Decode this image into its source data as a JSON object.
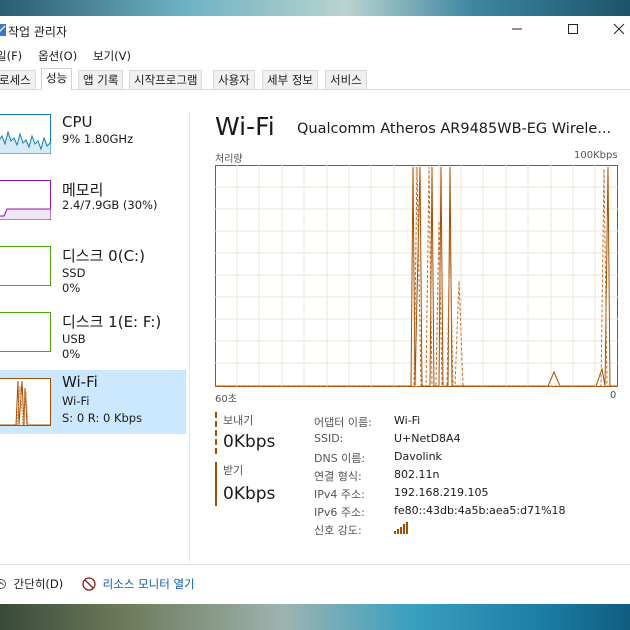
{
  "window": {
    "title": "작업 관리자"
  },
  "menu": [
    "일(F)",
    "옵션(O)",
    "보기(V)"
  ],
  "tabs": [
    "로세스",
    "성능",
    "앱 기록",
    "시작프로그램",
    "사용자",
    "세부 정보",
    "서비스"
  ],
  "sidebar": {
    "items": [
      {
        "title": "CPU",
        "sub1": "9% 1.80GHz",
        "sub2": "",
        "sub3": ""
      },
      {
        "title": "메모리",
        "sub1": "2.4/7.9GB (30%)",
        "sub2": "",
        "sub3": ""
      },
      {
        "title": "디스크 0(C:)",
        "sub1": "SSD",
        "sub2": "0%",
        "sub3": ""
      },
      {
        "title": "디스크 1(E: F:)",
        "sub1": "USB",
        "sub2": "0%",
        "sub3": ""
      },
      {
        "title": "Wi-Fi",
        "sub1": "Wi-Fi",
        "sub2": "S: 0 R: 0 Kbps",
        "sub3": ""
      }
    ]
  },
  "main": {
    "title": "Wi-Fi",
    "adapter": "Qualcomm Atheros AR9485WB-EG Wirele...",
    "throughput_label": "처리량",
    "max_label": "100Kbps",
    "time_label": "60초",
    "zero_label": "0",
    "send_label": "보내기",
    "send_value": "0Kbps",
    "recv_label": "받기",
    "recv_value": "0Kbps",
    "props": [
      {
        "label": "어댑터 이름:",
        "value": "Wi-Fi"
      },
      {
        "label": "SSID:",
        "value": "U+NetD8A4"
      },
      {
        "label": "DNS 이름:",
        "value": "Davolink"
      },
      {
        "label": "연결 형식:",
        "value": "802.11n"
      },
      {
        "label": "IPv4 주소:",
        "value": "192.168.219.105"
      },
      {
        "label": "IPv6 주소:",
        "value": "fe80::43db:4a5b:aea5:d71%18"
      },
      {
        "label": "신호 강도:",
        "value": ""
      }
    ]
  },
  "footer": {
    "less": "간단히(D)",
    "monitor": "리소스 모니터 열기"
  },
  "colors": {
    "cpu": "#117dbb",
    "memory": "#8b12ae",
    "disk": "#4da60c",
    "wifi": "#a74f01",
    "selected": "#cce8ff"
  }
}
